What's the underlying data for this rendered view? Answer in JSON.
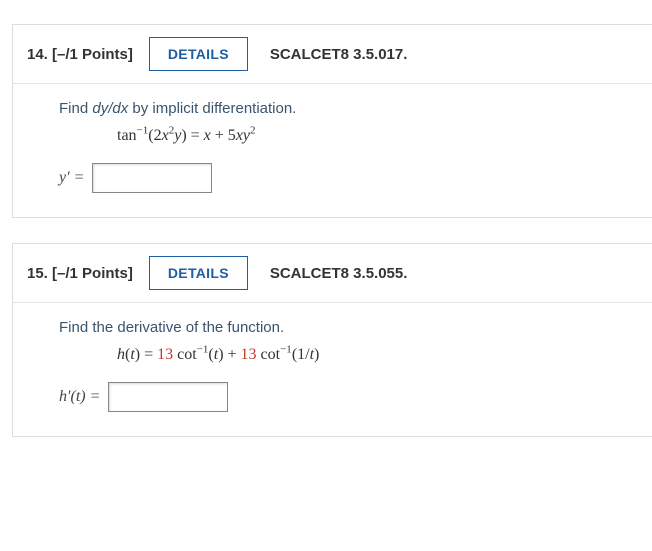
{
  "problems": [
    {
      "number": "14.",
      "points": "[–/1 Points]",
      "details_label": "DETAILS",
      "source": "SCALCET8 3.5.017.",
      "prompt_prefix": "Find ",
      "prompt_em": "dy/dx",
      "prompt_suffix": "  by implicit differentiation.",
      "formula_html": "tan<sup>−1</sup>(2<span class='it'>x</span><sup>2</sup><span class='it'>y</span>) = <span class='it'>x</span> + 5<span class='it'>xy</span><sup>2</sup>",
      "answer_lhs": "y′ ="
    },
    {
      "number": "15.",
      "points": "[–/1 Points]",
      "details_label": "DETAILS",
      "source": "SCALCET8 3.5.055.",
      "prompt_prefix": "Find the derivative of the function.",
      "prompt_em": "",
      "prompt_suffix": "",
      "formula_html": "<span class='it'>h</span>(<span class='it'>t</span>) = <span class='red'>13</span> cot<sup>−1</sup>(<span class='it'>t</span>) + <span class='red'>13</span> cot<sup>−1</sup>(1/<span class='it'>t</span>)",
      "answer_lhs": "h′(t) ="
    }
  ]
}
